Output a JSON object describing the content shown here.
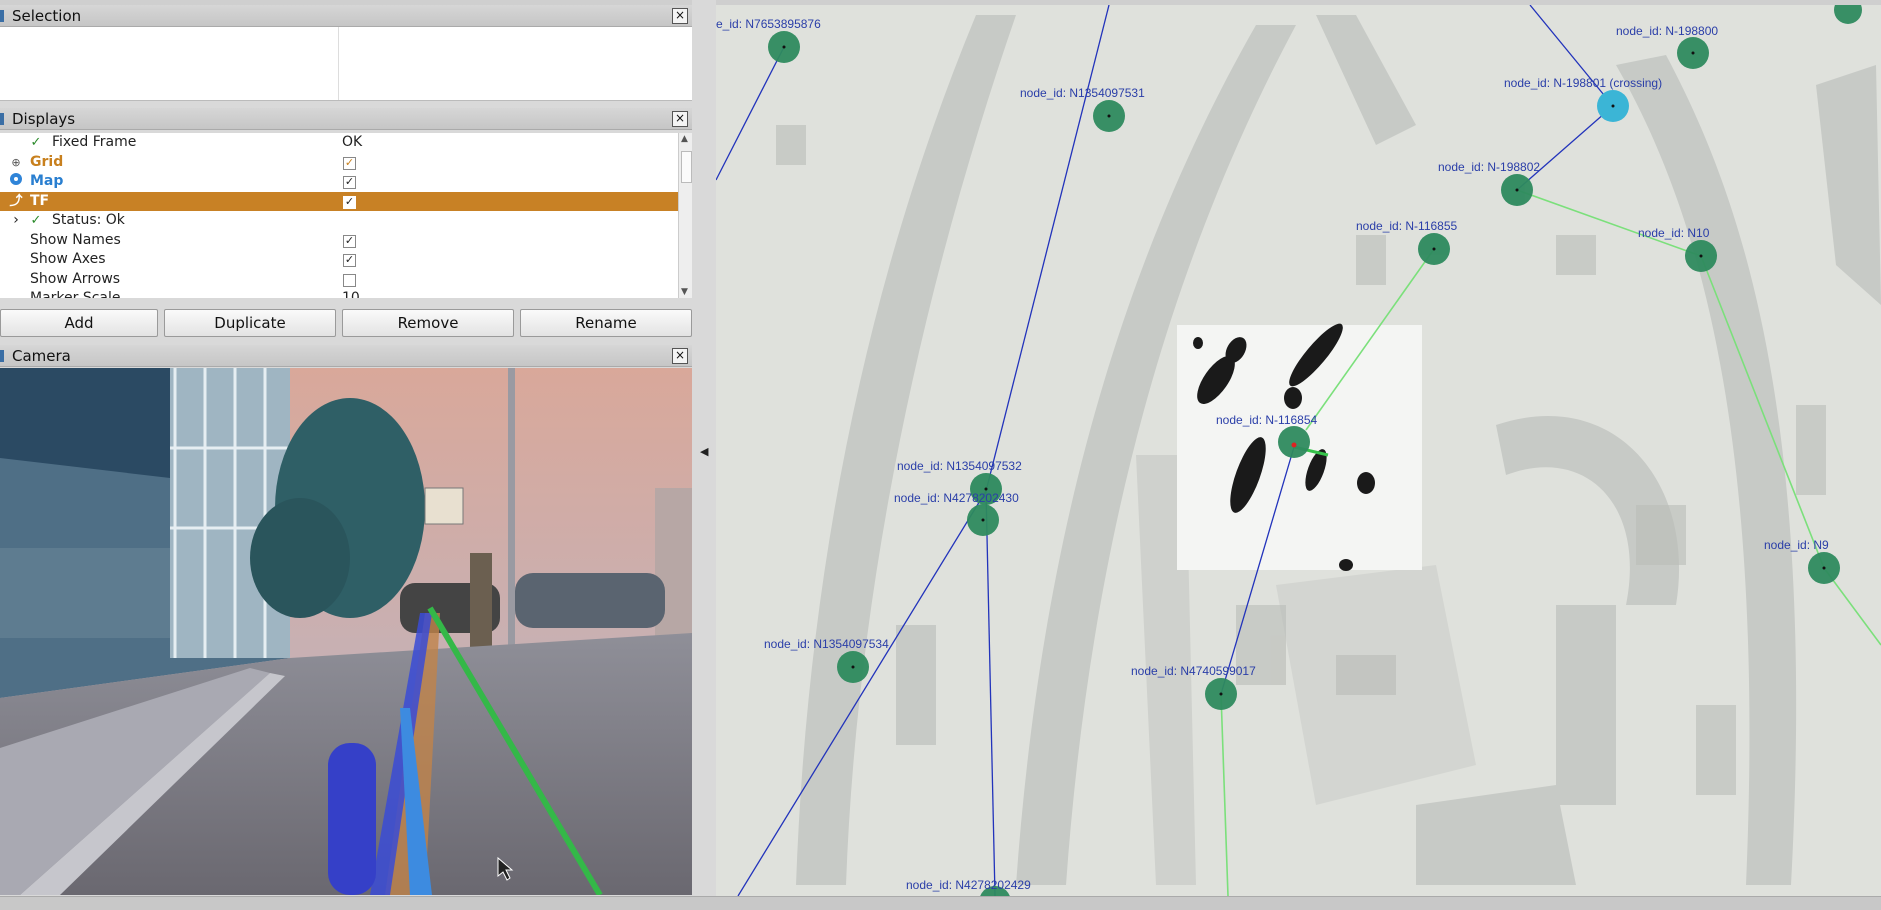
{
  "selection_panel": {
    "title": "Selection",
    "close": "×"
  },
  "displays_panel": {
    "title": "Displays",
    "close": "×",
    "rows": [
      {
        "label": "Fixed Frame",
        "value": "OK"
      },
      {
        "label": "Grid",
        "checked": true
      },
      {
        "label": "Map",
        "checked": true
      },
      {
        "label": "TF",
        "checked": true
      },
      {
        "label": "Status: Ok"
      },
      {
        "label": "Show Names",
        "checked": true
      },
      {
        "label": "Show Axes",
        "checked": true
      },
      {
        "label": "Show Arrows",
        "checked": false
      },
      {
        "label": "Marker Scale",
        "value": "10"
      }
    ],
    "checkmark": "✓",
    "expand_arrow": "›"
  },
  "buttons": {
    "add": "Add",
    "duplicate": "Duplicate",
    "remove": "Remove",
    "rename": "Rename"
  },
  "camera_panel": {
    "title": "Camera",
    "close": "×"
  },
  "map": {
    "nodes": [
      {
        "label": "e_id:  N7653895876"
      },
      {
        "label": "node_id:  N1354097531"
      },
      {
        "label": "node_id:  N-198800"
      },
      {
        "label": "node_id:  N-198801  (crossing)"
      },
      {
        "label": "node_id:  N-198802"
      },
      {
        "label": "node_id:  N-116855"
      },
      {
        "label": "node_id:  N10"
      },
      {
        "label": "node_id:  N-116854"
      },
      {
        "label": "node_id:  N1354097532"
      },
      {
        "label": "node_id:  N4278202430"
      },
      {
        "label": "node_id:  N9"
      },
      {
        "label": "node_id:  N1354097534"
      },
      {
        "label": "node_id:  N4740599017"
      },
      {
        "label": "node_id:  N4278202429"
      }
    ],
    "node_color": "#2e8a5e",
    "crossing_color": "#3bb5d6",
    "edge_color": "#2233bb",
    "path_color": "#7be07b"
  }
}
